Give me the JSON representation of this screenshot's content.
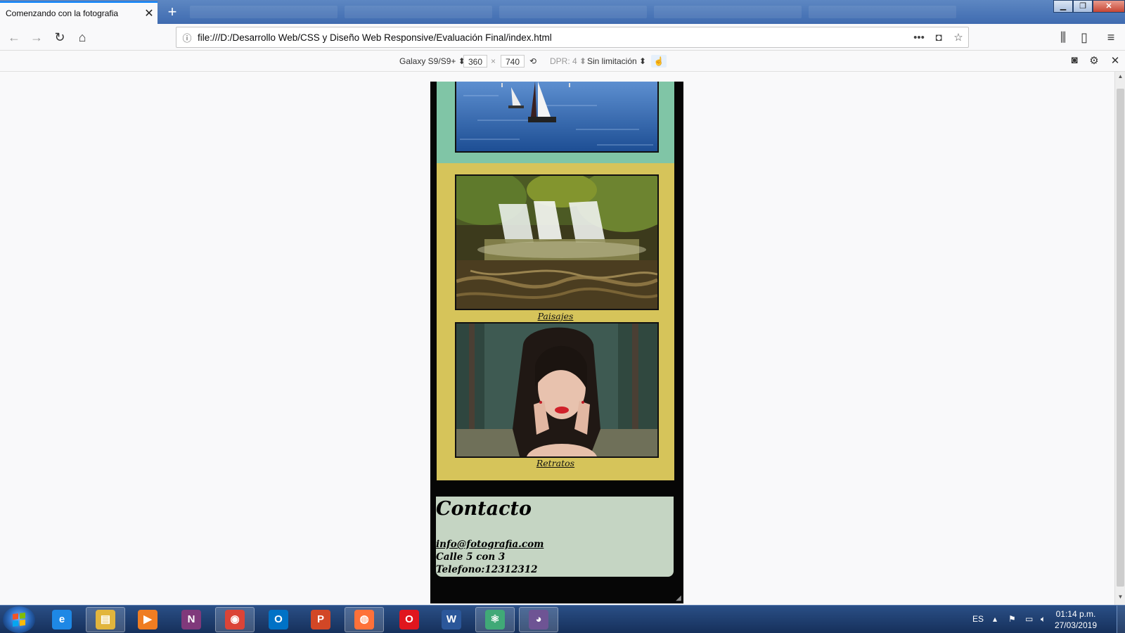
{
  "browser": {
    "tab_title": "Comenzando con la fotografia",
    "tab_close": "✕",
    "new_tab": "+",
    "url": "file:///D:/Desarrollo Web/CSS y Diseño Web Responsive/Evaluación Final/index.html",
    "window_buttons": {
      "minimize": "▁",
      "maximize": "❐",
      "close": "✕"
    }
  },
  "rdm": {
    "device": "Galaxy S9/S9+ ⬍",
    "width": "360",
    "times": "×",
    "height": "740",
    "dpr": "DPR: 4 ⬍",
    "throttle": "Sin limitación ⬍",
    "touch_icon": "touch-simulation-icon"
  },
  "page": {
    "captions": {
      "landscapes": "Paisajes",
      "portraits": "Retratos"
    },
    "contact": {
      "title": "Contacto",
      "email": "info@fotografia.com",
      "address": "Calle 5 con 3",
      "phone": "Telefono:12312312"
    },
    "colors": {
      "top_block": "#80c5a6",
      "main_block": "#d6c45a",
      "contact_block": "#c5d5c3",
      "page_background": "#060606"
    }
  },
  "taskbar": {
    "apps": [
      {
        "name": "internet-explorer",
        "glyph": "e",
        "color": "#1e88e5"
      },
      {
        "name": "file-explorer",
        "glyph": "▤",
        "color": "#e2b53d"
      },
      {
        "name": "media-player",
        "glyph": "▶",
        "color": "#ef7d22"
      },
      {
        "name": "onenote",
        "glyph": "N",
        "color": "#80397b"
      },
      {
        "name": "chrome",
        "glyph": "◉",
        "color": "#db4437"
      },
      {
        "name": "outlook",
        "glyph": "O",
        "color": "#0072c6"
      },
      {
        "name": "powerpoint",
        "glyph": "P",
        "color": "#d24726"
      },
      {
        "name": "firefox",
        "glyph": "◍",
        "color": "#ff7139"
      },
      {
        "name": "opera",
        "glyph": "O",
        "color": "#e0161e"
      },
      {
        "name": "word",
        "glyph": "W",
        "color": "#2b579a"
      },
      {
        "name": "atom",
        "glyph": "⚛",
        "color": "#40a977"
      },
      {
        "name": "github-desktop",
        "glyph": "◕",
        "color": "#6e5494"
      }
    ],
    "language": "ES",
    "time": "01:14 p.m.",
    "date": "27/03/2019"
  }
}
